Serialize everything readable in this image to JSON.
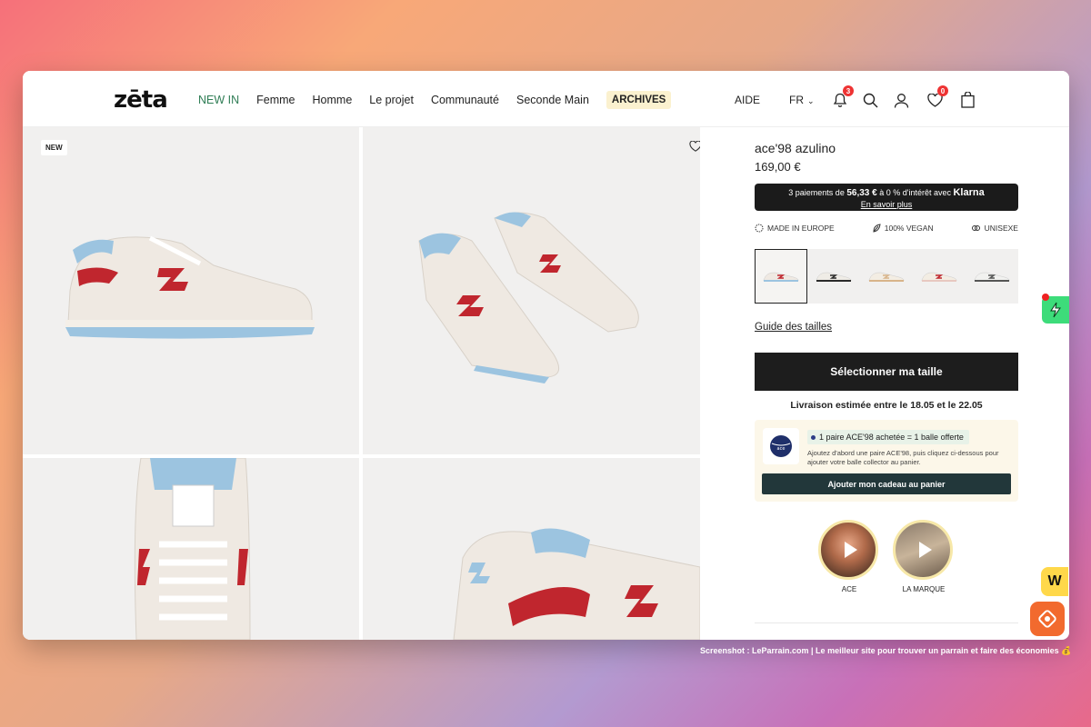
{
  "header": {
    "logo": "zēta",
    "nav": [
      "NEW IN",
      "Femme",
      "Homme",
      "Le projet",
      "Communauté",
      "Seconde Main",
      "ARCHIVES"
    ],
    "help": "AIDE",
    "lang": "FR",
    "notif_count": "3",
    "wishlist_count": "0",
    "icons": [
      "bell-icon",
      "search-icon",
      "user-icon",
      "heart-icon",
      "bag-icon"
    ]
  },
  "gallery": {
    "new_badge": "NEW"
  },
  "product": {
    "title": "ace'98 azulino",
    "price": "169,00 €",
    "klarna": {
      "prefix": "3 paiements de ",
      "amount": "56,33 €",
      "middle": " à 0 % d'intérêt avec ",
      "brand": "Klarna",
      "more": "En savoir plus"
    },
    "labels": [
      "MADE IN EUROPE",
      "100% VEGAN",
      "UNISEXE"
    ],
    "size_guide": "Guide des tailles",
    "select_size": "Sélectionner ma taille",
    "delivery": "Livraison estimée entre le 18.05 et le 22.05",
    "gift": {
      "headline": "1 paire ACE'98 achetée = 1 balle offerte",
      "text": "Ajoutez d'abord une paire ACE'98, puis cliquez ci-dessous pour ajouter votre balle collector au panier.",
      "button": "Ajouter mon cadeau au panier"
    },
    "videos": [
      "ACE",
      "LA MARQUE"
    ]
  },
  "colors": {
    "accent_red": "#c0262e",
    "accent_blue": "#9cc4e0",
    "dark": "#1d1d1d"
  },
  "credit": "Screenshot : LeParrain.com | Le meilleur site pour trouver un parrain et faire des économies 💰"
}
